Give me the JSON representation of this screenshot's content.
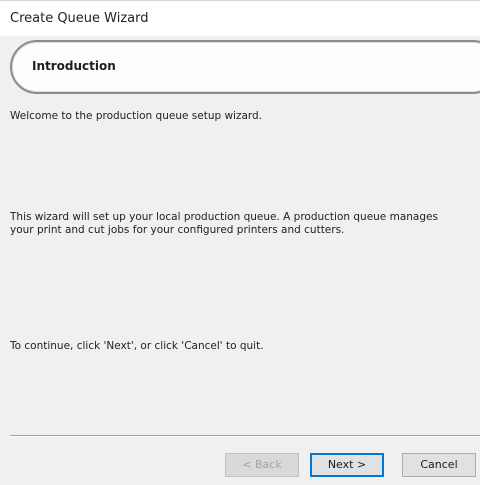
{
  "window": {
    "title": "Create Queue Wizard"
  },
  "header": {
    "title": "Introduction"
  },
  "content": {
    "welcome": "Welcome to the production queue setup wizard.",
    "description_line1": "This wizard will set up your local production queue.  A production queue manages",
    "description_line2": "your print and cut jobs for your configured printers and cutters.",
    "continue_hint": "To continue, click 'Next', or click 'Cancel' to quit."
  },
  "buttons": {
    "back": "< Back",
    "next": "Next >",
    "cancel": "Cancel"
  }
}
